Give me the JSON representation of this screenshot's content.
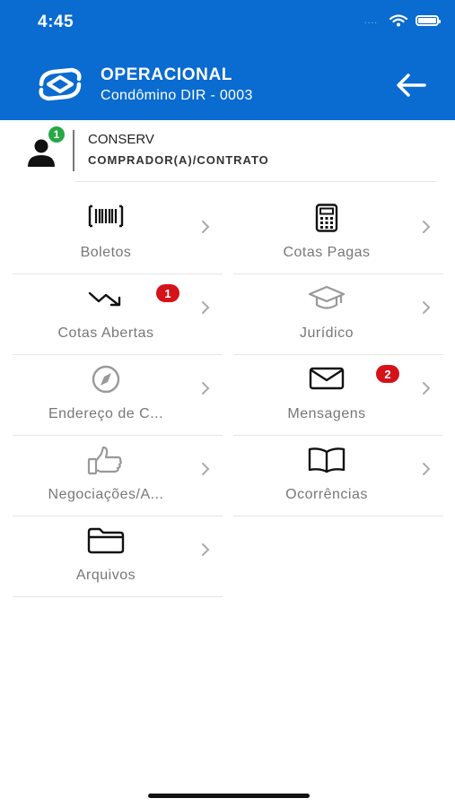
{
  "status_bar": {
    "time": "4:45",
    "signal": "....",
    "wifi_icon": "wifi-icon",
    "battery_icon": "battery-icon"
  },
  "header": {
    "title": "OPERACIONAL",
    "subtitle": "Condômino DIR - 0003",
    "logo_icon": "app-logo-icon",
    "back_icon": "arrow-left-icon",
    "background_color": "#0a6bd0"
  },
  "user": {
    "name": "CONSERV",
    "role": "COMPRADOR(A)/CONTRATO",
    "badge": "1",
    "badge_color": "#28a745",
    "avatar_icon": "user-icon"
  },
  "menu": [
    {
      "label": "Boletos",
      "icon": "barcode-icon",
      "badge": ""
    },
    {
      "label": "Cotas Pagas",
      "icon": "calculator-icon",
      "badge": ""
    },
    {
      "label": "Cotas Abertas",
      "icon": "trending-down-icon",
      "badge": "1"
    },
    {
      "label": "Jurídico",
      "icon": "graduation-cap-icon",
      "badge": ""
    },
    {
      "label": "Endereço de C...",
      "icon": "compass-icon",
      "badge": ""
    },
    {
      "label": "Mensagens",
      "icon": "envelope-icon",
      "badge": "2"
    },
    {
      "label": "Negociações/A...",
      "icon": "thumbs-up-icon",
      "badge": ""
    },
    {
      "label": "Ocorrências",
      "icon": "book-icon",
      "badge": ""
    },
    {
      "label": "Arquivos",
      "icon": "folder-icon",
      "badge": ""
    }
  ],
  "badge_color": "#d41218"
}
